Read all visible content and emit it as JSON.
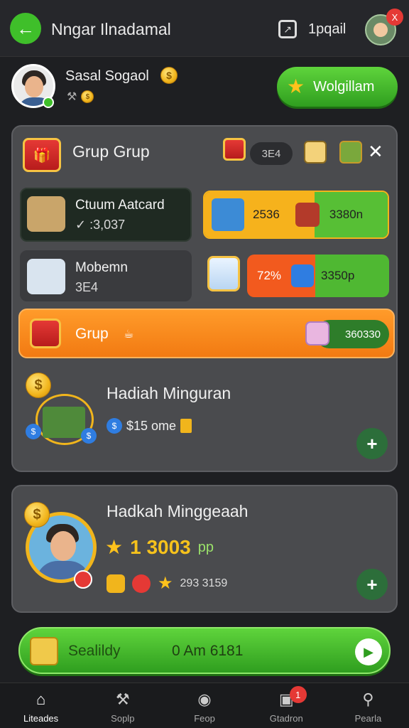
{
  "header": {
    "back_icon": "back-arrow-icon",
    "title": "Nngar Ilnadamal",
    "share_icon": "share-box-icon",
    "right_text": "1pqail",
    "badge": "X"
  },
  "profile": {
    "name": "Sasal Sogaol",
    "button_label": "Wolgillam"
  },
  "group_panel": {
    "title": "Grup Grup",
    "pill_value": "3E4",
    "rows": [
      {
        "title": "Ctuum Aatcard",
        "subtitle": "✓ :3,037",
        "bar_left": "2536",
        "bar_right": "3380n"
      },
      {
        "title": "Mobemn",
        "subtitle": "3E4",
        "bar_left": "72%",
        "bar_right": "3350p"
      }
    ],
    "orange_row": {
      "label": "Grup",
      "count": "360330"
    },
    "weekly": {
      "title": "Hadiah Minguran",
      "value": "$15 ome"
    }
  },
  "weekly_panel": {
    "title": "Hadkah Minggeaah",
    "value": "1 3003",
    "unit": "pp",
    "small_values": "293 3159"
  },
  "cta": {
    "label": "Sealildy",
    "value": "0 Am 6181"
  },
  "nav": [
    {
      "label": "Liteades",
      "icon": "home-icon"
    },
    {
      "label": "Soplp",
      "icon": "tools-icon"
    },
    {
      "label": "Feop",
      "icon": "circle-icon"
    },
    {
      "label": "Gtadron",
      "icon": "inbox-icon",
      "badge": "1"
    },
    {
      "label": "Pearla",
      "icon": "search-icon"
    }
  ],
  "colors": {
    "accent_green": "#3fbf2a",
    "orange": "#f27a12",
    "gold": "#f1b51c",
    "badge_red": "#e53935"
  }
}
